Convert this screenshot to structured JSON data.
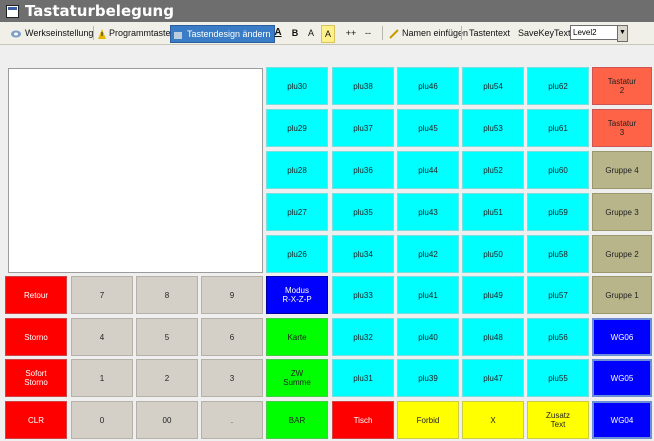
{
  "title": "Tastaturbelegung",
  "toolbar": {
    "werkseinstellung": "Werkseinstellung",
    "programmtasten": "Programmtasten",
    "tastendesign": "Tastendesign ändern",
    "font_buttons": [
      "A",
      "B",
      "A",
      "A",
      "++",
      "--"
    ],
    "namen_einfuegen": "Namen einfügen",
    "tastentext": "Tastentext",
    "savekeytext": "SaveKeyText",
    "level_value": "Level2"
  },
  "keys": {
    "r1": [
      "plu30",
      "plu38",
      "plu46",
      "plu54",
      "plu62",
      "Tastatur\n2"
    ],
    "r2": [
      "plu29",
      "plu37",
      "plu45",
      "plu53",
      "plu61",
      "Tastatur\n3"
    ],
    "r3": [
      "plu28",
      "plu36",
      "plu44",
      "plu52",
      "plu60",
      "Gruppe 4"
    ],
    "r4": [
      "plu27",
      "plu35",
      "plu43",
      "plu51",
      "plu59",
      "Gruppe 3"
    ],
    "r5": [
      "plu26",
      "plu34",
      "plu42",
      "plu50",
      "plu58",
      "Gruppe 2"
    ],
    "r6": [
      "Retour",
      "7",
      "8",
      "9",
      "Modus\nR-X-Z-P",
      "plu33",
      "plu41",
      "plu49",
      "plu57",
      "Gruppe 1"
    ],
    "r7": [
      "Storno",
      "4",
      "5",
      "6",
      "Karte",
      "plu32",
      "plu40",
      "plu48",
      "plu56",
      "WG06"
    ],
    "r8": [
      "Sofort\nStorno",
      "1",
      "2",
      "3",
      "ZW\nSumme",
      "plu31",
      "plu39",
      "plu47",
      "plu55",
      "WG05"
    ],
    "r9": [
      "CLR",
      "0",
      "00",
      ".",
      "BAR",
      "Tisch",
      "Forbid",
      "X",
      "Zusatz\nText",
      "WG04"
    ]
  },
  "colors": {
    "cyan": "#00ffff",
    "red": "#ff0000",
    "gray": "#d4d0c8",
    "blue": "#0000ff",
    "green": "#00ff00",
    "yellow": "#ffff00",
    "salmon": "#ff6347",
    "olive": "#b8b58b"
  }
}
